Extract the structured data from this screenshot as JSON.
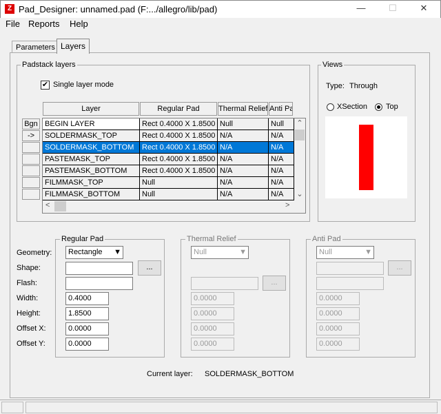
{
  "window": {
    "title": "Pad_Designer: unnamed.pad (F:.../allegro/lib/pad)",
    "minimize": "—",
    "maximize": "☐",
    "close": "✕"
  },
  "menu": [
    "File",
    "Reports",
    "Help"
  ],
  "tabs": [
    "Parameters",
    "Layers"
  ],
  "padstack": {
    "label": "Padstack layers",
    "single_layer_mode": "Single layer mode",
    "single_checked": true,
    "headers": [
      "Layer",
      "Regular Pad",
      "Thermal Relief",
      "Anti Pad"
    ],
    "row_buttons": [
      "Bgn",
      "->",
      "",
      "",
      "",
      "",
      ""
    ],
    "rows": [
      [
        "BEGIN LAYER",
        "Rect 0.4000 X 1.8500",
        "Null",
        "Null"
      ],
      [
        "SOLDERMASK_TOP",
        "Rect 0.4000 X 1.8500",
        "N/A",
        "N/A"
      ],
      [
        "SOLDERMASK_BOTTOM",
        "Rect 0.4000 X 1.8500",
        "N/A",
        "N/A"
      ],
      [
        "PASTEMASK_TOP",
        "Rect 0.4000 X 1.8500",
        "N/A",
        "N/A"
      ],
      [
        "PASTEMASK_BOTTOM",
        "Rect 0.4000 X 1.8500",
        "N/A",
        "N/A"
      ],
      [
        "FILMMASK_TOP",
        "Null",
        "N/A",
        "N/A"
      ],
      [
        "FILMMASK_BOTTOM",
        "Null",
        "N/A",
        "N/A"
      ]
    ],
    "selected_row": 2
  },
  "views": {
    "label": "Views",
    "type_label": "Type:",
    "type_value": "Through",
    "xsection": "XSection",
    "top": "Top",
    "selected": "Top",
    "pad_color": "#ff0000"
  },
  "fields": {
    "labels": [
      "Geometry:",
      "Shape:",
      "Flash:",
      "Width:",
      "Height:",
      "Offset X:",
      "Offset Y:"
    ]
  },
  "regular": {
    "label": "Regular Pad",
    "geometry": "Rectangle",
    "shape": "",
    "flash": "",
    "width": "0.4000",
    "height": "1.8500",
    "offx": "0.0000",
    "offy": "0.0000",
    "browse": "..."
  },
  "thermal": {
    "label": "Thermal Relief",
    "geometry": "Null",
    "width": "0.0000",
    "height": "0.0000",
    "offx": "0.0000",
    "offy": "0.0000",
    "browse": "..."
  },
  "anti": {
    "label": "Anti Pad",
    "geometry": "Null",
    "width": "0.0000",
    "height": "0.0000",
    "offx": "0.0000",
    "offy": "0.0000",
    "browse": "..."
  },
  "current": {
    "label": "Current layer:",
    "value": "SOLDERMASK_BOTTOM"
  }
}
